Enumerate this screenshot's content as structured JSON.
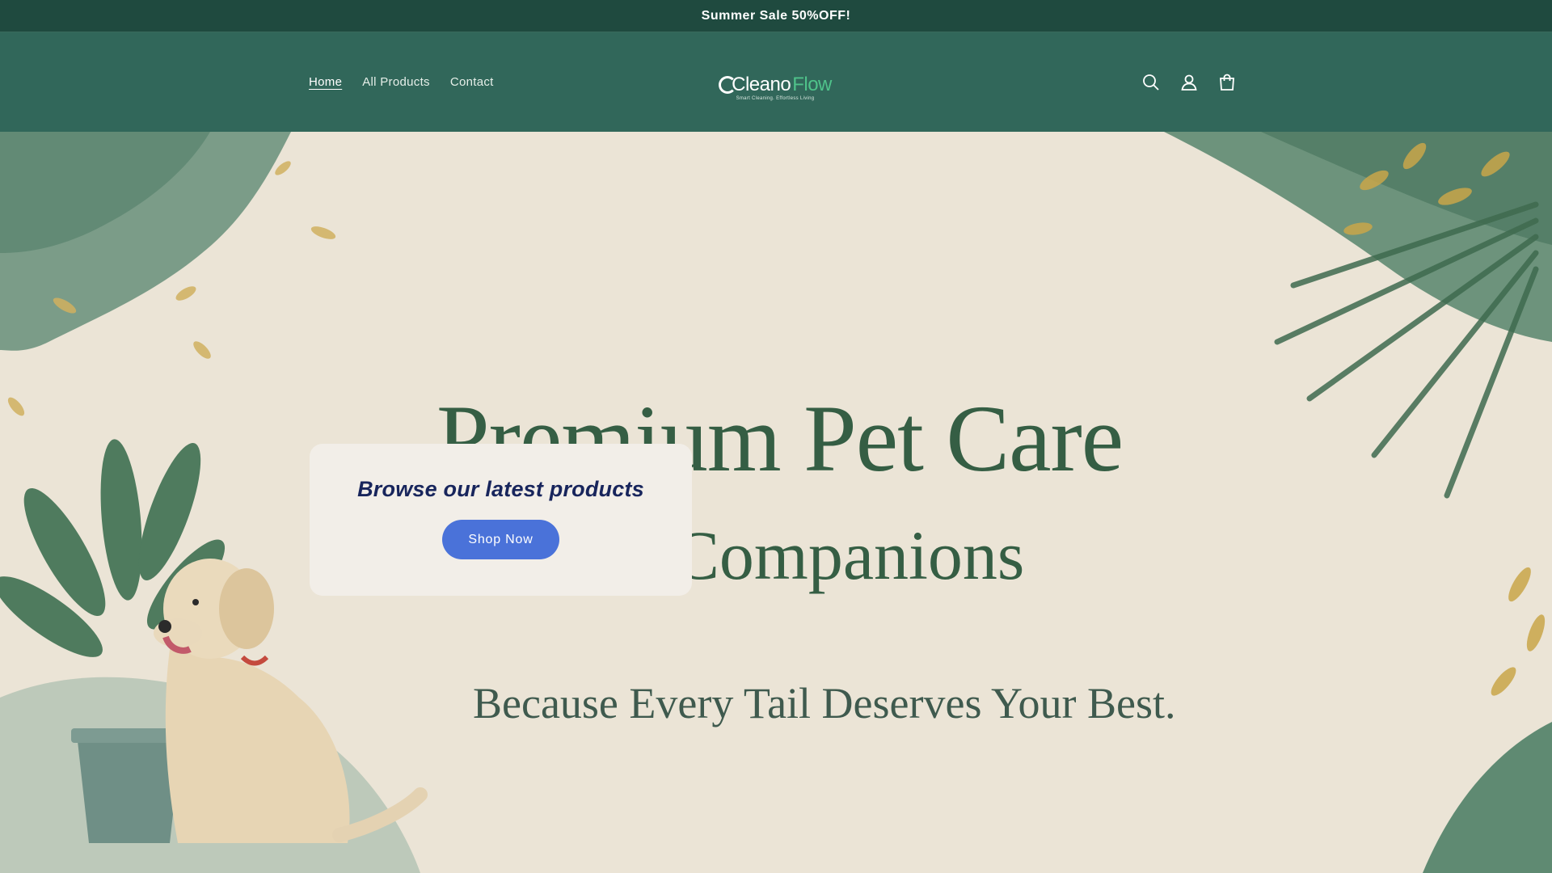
{
  "announcement": {
    "text": "Summer Sale 50%OFF!"
  },
  "nav": {
    "items": [
      {
        "label": "Home",
        "active": true
      },
      {
        "label": "All Products"
      },
      {
        "label": "Contact"
      }
    ]
  },
  "logo": {
    "word1": "Cleano",
    "word2": "Flow",
    "tagline": "Smart Cleaning. Effortless Living"
  },
  "header_icons": [
    "search-icon",
    "account-icon",
    "cart-icon"
  ],
  "hero": {
    "line1": "Premium Pet Care",
    "line2": "loved Companions",
    "line3": "Because Every Tail Deserves Your Best."
  },
  "promo": {
    "title": "Browse our latest products",
    "button": "Shop Now"
  },
  "colors": {
    "topbar": "#1f4a3f",
    "header": "#31675a",
    "button": "#4a72d9",
    "heading_text": "#355e44",
    "promo_title": "#18255c"
  }
}
